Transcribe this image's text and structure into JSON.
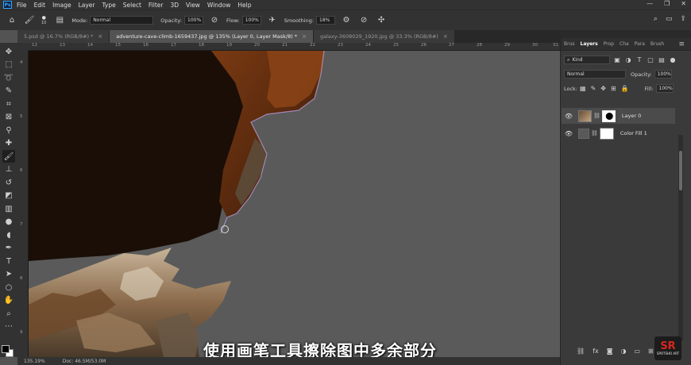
{
  "app": {
    "logo_text": "Ps"
  },
  "menu": [
    "File",
    "Edit",
    "Image",
    "Layer",
    "Type",
    "Select",
    "Filter",
    "3D",
    "View",
    "Window",
    "Help"
  ],
  "window_controls": [
    "—",
    "❐",
    "✕"
  ],
  "options": {
    "brush_size": "10",
    "mode_label": "Mode:",
    "mode_value": "Normal",
    "opacity_label": "Opacity:",
    "opacity_value": "100%",
    "flow_label": "Flow:",
    "flow_value": "100%",
    "smoothing_label": "Smoothing:",
    "smoothing_value": "18%"
  },
  "tabs": [
    {
      "label": "5.psd @ 16.7% (RGB/8#) *"
    },
    {
      "label": "adventure-cave-climb-1659437.jpg @ 135% (Layer 0, Layer Mask/8) *"
    },
    {
      "label": "galaxy-3608029_1920.jpg @ 33.3% (RGB/8#)"
    }
  ],
  "ruler": {
    "h_labels": [
      "12",
      "13",
      "14",
      "15",
      "16",
      "17",
      "18",
      "19",
      "20",
      "21",
      "22",
      "23",
      "24",
      "25",
      "26",
      "27",
      "28",
      "29",
      "30",
      "31"
    ],
    "v_labels": [
      "4",
      "5",
      "6",
      "7",
      "8",
      "9"
    ]
  },
  "status": {
    "zoom": "135.19%",
    "doc": "Doc: 46.5M/53.0M"
  },
  "subtitle": "使用画笔工具擦除图中多余部分",
  "panel": {
    "tabs": [
      "Brus",
      "Layers",
      "Prop",
      "Cha",
      "Para",
      "Brush"
    ],
    "filter_value": "Kind",
    "blend_value": "Normal",
    "opacity_label": "Opacity:",
    "opacity_value": "100%",
    "lock_label": "Lock:",
    "fill_label": "Fill:",
    "fill_value": "100%",
    "layers": [
      {
        "name": "Layer 0"
      },
      {
        "name": "Color Fill 1"
      }
    ]
  },
  "watermark": {
    "mark": "SR",
    "text": "SPOTSHO ART"
  },
  "colors": {
    "accent": "#31a8ff",
    "canvas_bg": "#5a5a5a",
    "panel_bg": "#3a3a3a",
    "logo_red": "#d8261e"
  }
}
